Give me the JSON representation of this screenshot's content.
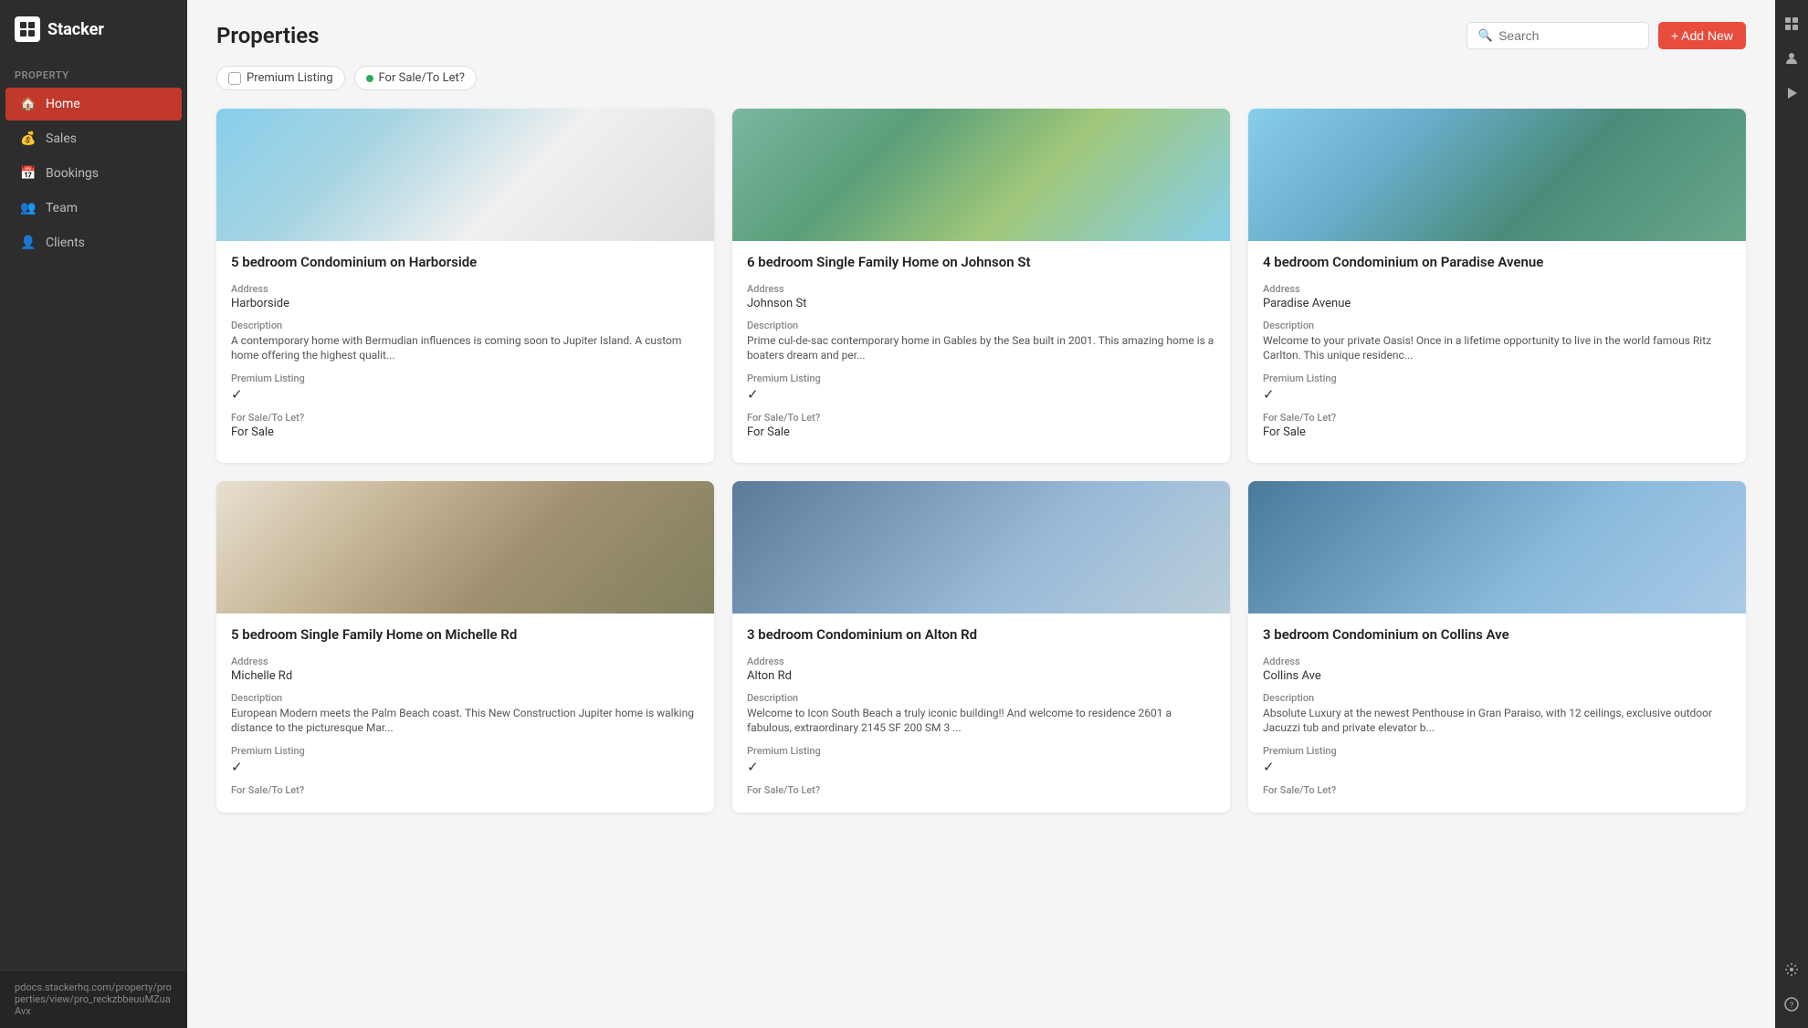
{
  "app": {
    "name": "Stacker"
  },
  "sidebar": {
    "section_label": "Property",
    "items": [
      {
        "id": "home",
        "label": "Home",
        "icon": "🏠",
        "active": true
      },
      {
        "id": "sales",
        "label": "Sales",
        "icon": "💰",
        "active": false
      },
      {
        "id": "bookings",
        "label": "Bookings",
        "icon": "📅",
        "active": false
      },
      {
        "id": "team",
        "label": "Team",
        "icon": "👥",
        "active": false
      },
      {
        "id": "clients",
        "label": "Clients",
        "icon": "👤",
        "active": false
      }
    ],
    "footer_url": "pdocs.stackerhq.com/property/properties/view/pro_reckzbbeuuMZuaAvx"
  },
  "page": {
    "title": "Properties"
  },
  "header": {
    "search_placeholder": "Search",
    "add_new_label": "+ Add New"
  },
  "filters": [
    {
      "id": "premium",
      "label": "Premium Listing",
      "type": "checkbox"
    },
    {
      "id": "forsale",
      "label": "For Sale/To Let?",
      "type": "active"
    }
  ],
  "properties": [
    {
      "id": 1,
      "title": "5 bedroom Condominium on Harborside",
      "address_label": "Address",
      "address": "Harborside",
      "description_label": "Description",
      "description": "A contemporary home with Bermudian influences is coming soon to Jupiter Island. A custom home offering the highest qualit...",
      "premium_label": "Premium Listing",
      "premium": true,
      "sale_label": "For Sale/To Let?",
      "sale_value": "For Sale",
      "img_class": "img-1"
    },
    {
      "id": 2,
      "title": "6 bedroom Single Family Home on Johnson St",
      "address_label": "Address",
      "address": "Johnson St",
      "description_label": "Description",
      "description": "Prime cul-de-sac contemporary home in Gables by the Sea built in 2001. This amazing home is a boaters dream and per...",
      "premium_label": "Premium Listing",
      "premium": true,
      "sale_label": "For Sale/To Let?",
      "sale_value": "For Sale",
      "img_class": "img-2"
    },
    {
      "id": 3,
      "title": "4 bedroom Condominium on Paradise Avenue",
      "address_label": "Address",
      "address": "Paradise Avenue",
      "description_label": "Description",
      "description": "Welcome to your private Oasis! Once in a lifetime opportunity to live in the world famous Ritz Carlton. This unique residenc...",
      "premium_label": "Premium Listing",
      "premium": true,
      "sale_label": "For Sale/To Let?",
      "sale_value": "For Sale",
      "img_class": "img-3"
    },
    {
      "id": 4,
      "title": "5 bedroom Single Family Home on Michelle Rd",
      "address_label": "Address",
      "address": "Michelle Rd",
      "description_label": "Description",
      "description": "European Modern meets the Palm Beach coast. This New Construction Jupiter home is walking distance to the picturesque Mar...",
      "premium_label": "Premium Listing",
      "premium": true,
      "sale_label": "For Sale/To Let?",
      "sale_value": "",
      "img_class": "img-4"
    },
    {
      "id": 5,
      "title": "3 bedroom Condominium on Alton Rd",
      "address_label": "Address",
      "address": "Alton Rd",
      "description_label": "Description",
      "description": "Welcome to Icon South Beach a truly iconic building!! And welcome to residence 2601 a fabulous, extraordinary 2145 SF 200 SM 3 ...",
      "premium_label": "Premium Listing",
      "premium": true,
      "sale_label": "For Sale/To Let?",
      "sale_value": "",
      "img_class": "img-5"
    },
    {
      "id": 6,
      "title": "3 bedroom Condominium on Collins Ave",
      "address_label": "Address",
      "address": "Collins Ave",
      "description_label": "Description",
      "description": "Absolute Luxury at the newest Penthouse in Gran Paraiso, with 12 ceilings, exclusive outdoor Jacuzzi tub and private elevator b...",
      "premium_label": "Premium Listing",
      "premium": true,
      "sale_label": "For Sale/To Let?",
      "sale_value": "",
      "img_class": "img-6"
    }
  ],
  "right_rail": {
    "icons": [
      "⊞",
      "👤",
      "▶",
      "⚙"
    ]
  },
  "help_button": "?"
}
